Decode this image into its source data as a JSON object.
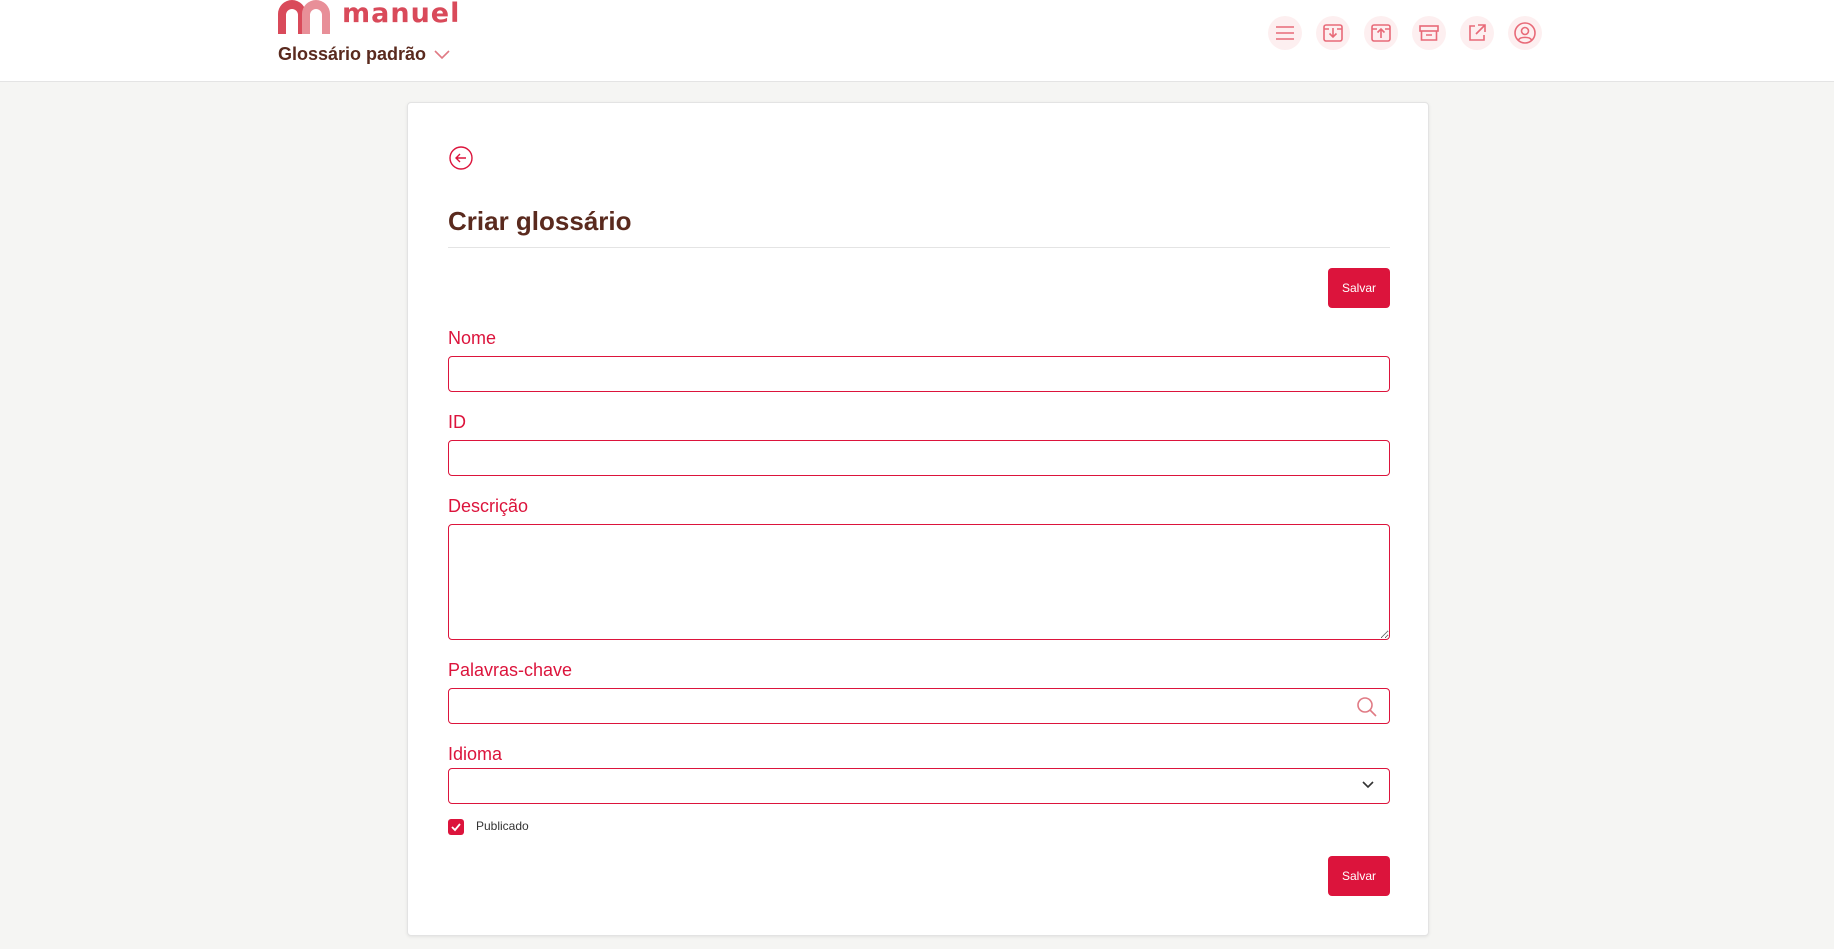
{
  "app": {
    "logo_text": "manuel",
    "accent_color": "#dc143c",
    "title_color": "#5a2a1e"
  },
  "header": {
    "glossary_selector": "Glossário padrão",
    "toolbar_icons": [
      "menu-icon",
      "download-icon",
      "upload-icon",
      "archive-icon",
      "external-link-icon",
      "user-icon"
    ]
  },
  "form": {
    "title": "Criar glossário",
    "save_label": "Salvar",
    "fields": {
      "name": {
        "label": "Nome",
        "value": ""
      },
      "id": {
        "label": "ID",
        "value": ""
      },
      "description": {
        "label": "Descrição",
        "value": ""
      },
      "keywords": {
        "label": "Palavras-chave",
        "value": ""
      },
      "language": {
        "label": "Idioma",
        "value": ""
      }
    },
    "published": {
      "label": "Publicado",
      "checked": true
    }
  }
}
